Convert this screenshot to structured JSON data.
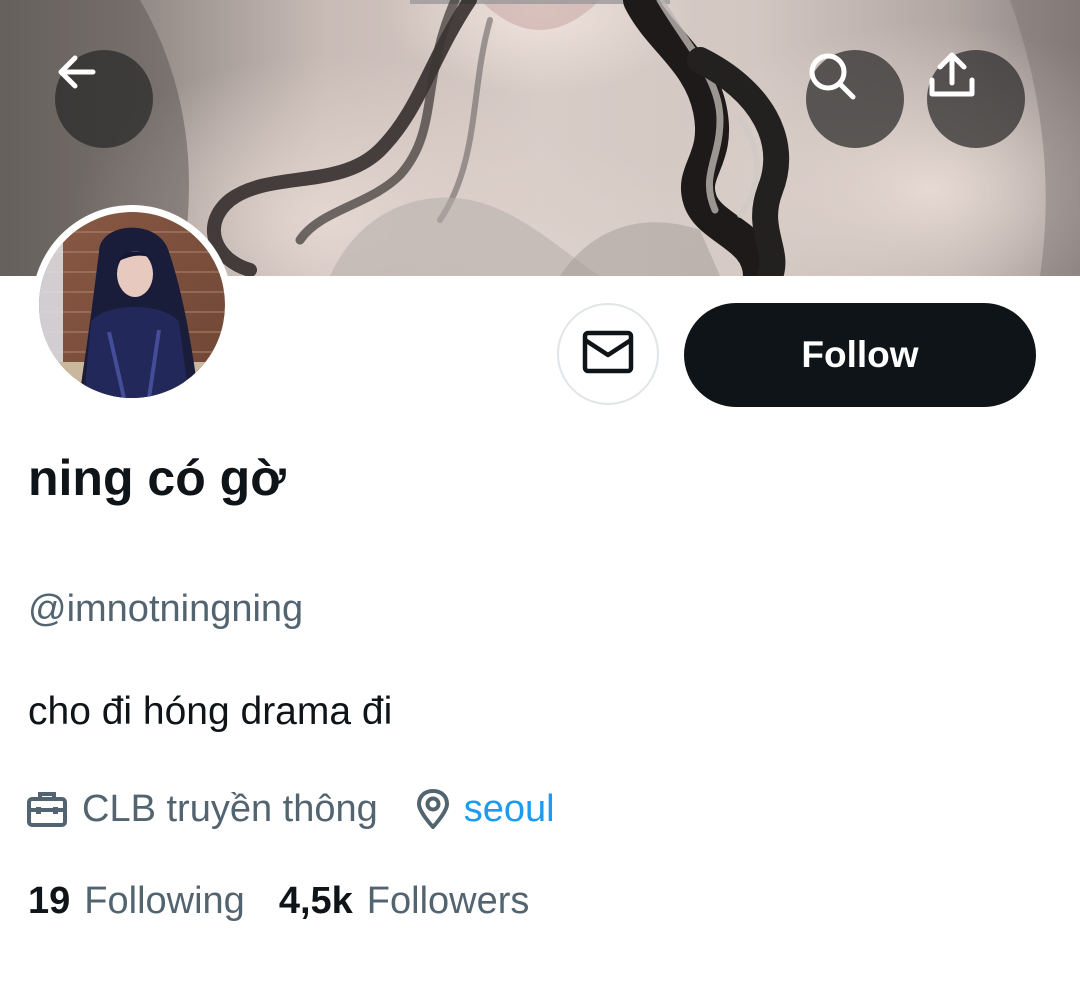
{
  "header": {
    "back_icon": "arrow-left-icon",
    "search_icon": "search-icon",
    "share_icon": "share-upload-icon"
  },
  "actions": {
    "message_icon": "envelope-icon",
    "follow_label": "Follow"
  },
  "profile": {
    "display_name": "ning có gờ",
    "handle": "@imnotningning",
    "bio": "cho đi hóng drama đi",
    "work": "CLB truyền thông",
    "work_icon": "briefcase-icon",
    "location": "seoul",
    "location_icon": "location-pin-icon"
  },
  "stats": {
    "following_count": "19",
    "following_label": "Following",
    "followers_count": "4,5k",
    "followers_label": "Followers"
  },
  "colors": {
    "text_primary": "#0f1419",
    "text_secondary": "#536471",
    "link": "#1d9bf0",
    "follow_button_bg": "#0f1419",
    "follow_button_text": "#ffffff"
  }
}
